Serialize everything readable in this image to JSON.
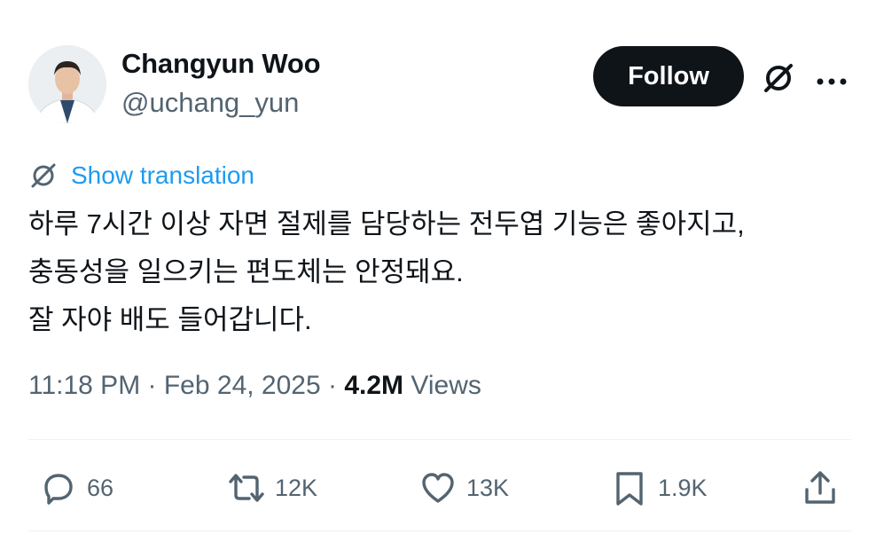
{
  "author": {
    "display_name": "Changyun Woo",
    "handle": "@uchang_yun"
  },
  "follow_label": "Follow",
  "translation_label": "Show translation",
  "tweet_lines": [
    "하루 7시간 이상 자면 절제를 담당하는 전두엽 기능은 좋아지고,",
    "충동성을 일으키는 편도체는 안정돼요.",
    "잘 자야 배도 들어갑니다."
  ],
  "meta": {
    "time": "11:18 PM",
    "separator": " · ",
    "date": "Feb 24, 2025",
    "views_count": "4.2M",
    "views_label": "Views"
  },
  "actions": {
    "replies": "66",
    "reposts": "12K",
    "likes": "13K",
    "bookmarks": "1.9K"
  },
  "icons": {
    "grok": "grok-icon",
    "more": "more-icon",
    "reply": "reply-icon",
    "repost": "repost-icon",
    "like": "heart-icon",
    "bookmark": "bookmark-icon",
    "share": "share-icon"
  },
  "colors": {
    "text": "#0f1419",
    "secondary": "#536471",
    "link": "#1d9bf0",
    "button": "#0f1419",
    "divider": "#eff3f4"
  }
}
